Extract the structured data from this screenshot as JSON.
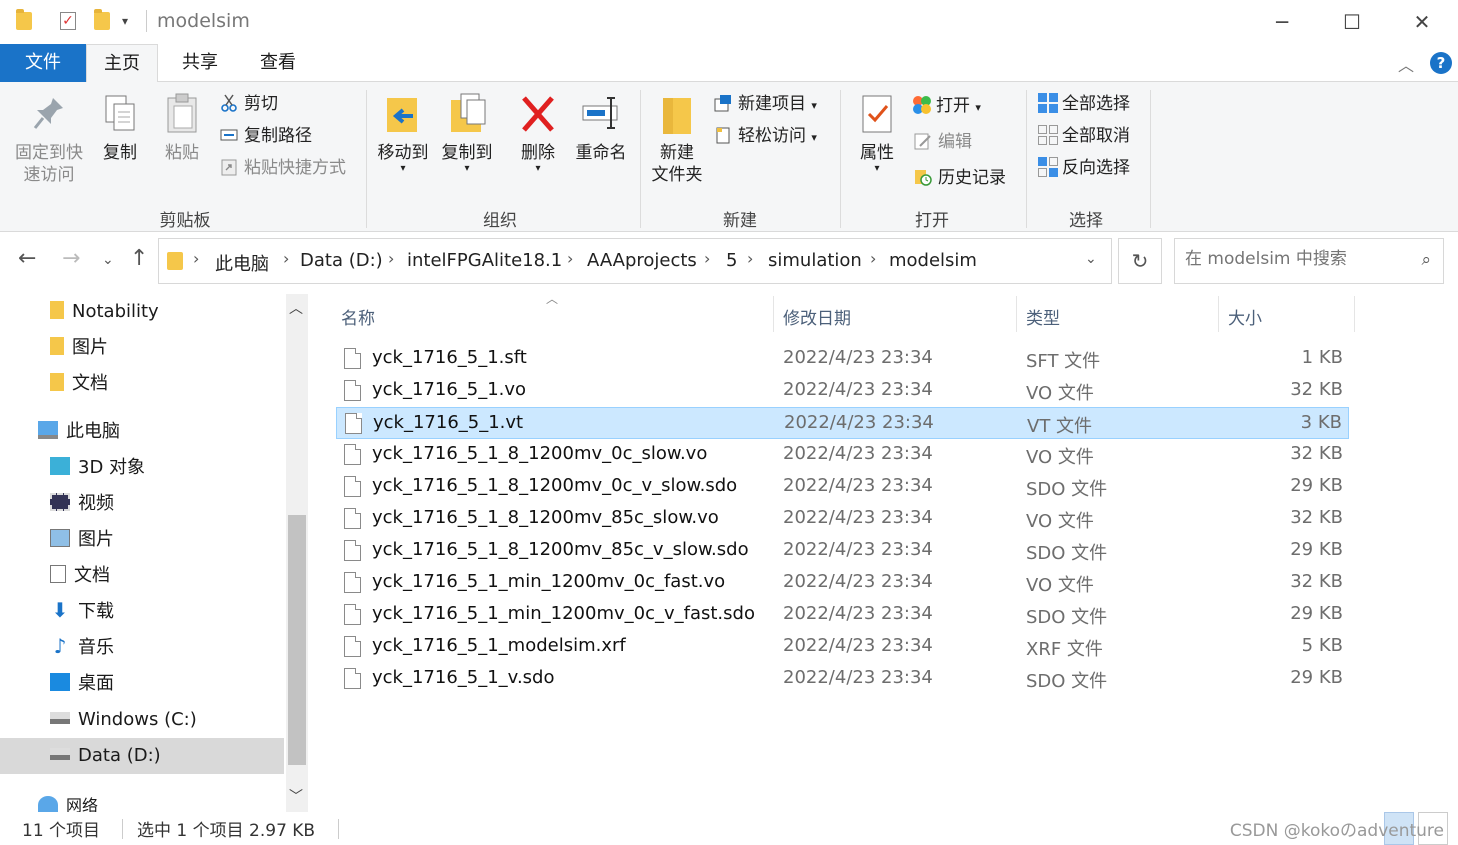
{
  "window": {
    "title": "modelsim",
    "min_glyph": "─",
    "max_glyph": "☐",
    "close_glyph": "✕"
  },
  "tabs": {
    "file": "文件",
    "home": "主页",
    "share": "共享",
    "view": "查看"
  },
  "ribbon": {
    "clipboard": {
      "label": "剪贴板",
      "pin_line1": "固定到快",
      "pin_line2": "速访问",
      "copy": "复制",
      "paste": "粘贴",
      "cut": "剪切",
      "copy_path": "复制路径",
      "paste_shortcut": "粘贴快捷方式"
    },
    "organize": {
      "label": "组织",
      "move_to": "移动到",
      "copy_to": "复制到",
      "delete": "删除",
      "rename": "重命名"
    },
    "new": {
      "label": "新建",
      "new_folder_line1": "新建",
      "new_folder_line2": "文件夹",
      "new_item": "新建项目",
      "easy_access": "轻松访问"
    },
    "open": {
      "label": "打开",
      "properties": "属性",
      "open": "打开",
      "edit": "编辑",
      "history": "历史记录"
    },
    "select": {
      "label": "选择",
      "select_all": "全部选择",
      "select_none": "全部取消",
      "invert": "反向选择"
    }
  },
  "breadcrumb": [
    "此电脑",
    "Data (D:)",
    "intelFPGAlite18.1",
    "AAAprojects",
    "5",
    "simulation",
    "modelsim"
  ],
  "search": {
    "placeholder": "在 modelsim 中搜索"
  },
  "sidebar": {
    "items": [
      {
        "label": "Notability",
        "icon": "folder-icon"
      },
      {
        "label": "图片",
        "icon": "folder-icon"
      },
      {
        "label": "文档",
        "icon": "folder-icon"
      },
      {
        "label": "此电脑",
        "icon": "computer-icon"
      },
      {
        "label": "3D 对象",
        "icon": "cube-icon"
      },
      {
        "label": "视频",
        "icon": "video-icon"
      },
      {
        "label": "图片",
        "icon": "pictures-icon"
      },
      {
        "label": "文档",
        "icon": "documents-icon"
      },
      {
        "label": "下载",
        "icon": "download-icon"
      },
      {
        "label": "音乐",
        "icon": "music-icon"
      },
      {
        "label": "桌面",
        "icon": "desktop-icon"
      },
      {
        "label": "Windows (C:)",
        "icon": "drive-icon"
      },
      {
        "label": "Data (D:)",
        "icon": "drive-icon"
      },
      {
        "label": "网络",
        "icon": "network-icon"
      }
    ],
    "selected": "Data (D:)"
  },
  "columns": {
    "name": "名称",
    "date": "修改日期",
    "type": "类型",
    "size": "大小"
  },
  "files": [
    {
      "name": "yck_1716_5_1.sft",
      "date": "2022/4/23 23:34",
      "type": "SFT 文件",
      "size": "1 KB"
    },
    {
      "name": "yck_1716_5_1.vo",
      "date": "2022/4/23 23:34",
      "type": "VO 文件",
      "size": "32 KB"
    },
    {
      "name": "yck_1716_5_1.vt",
      "date": "2022/4/23 23:34",
      "type": "VT 文件",
      "size": "3 KB"
    },
    {
      "name": "yck_1716_5_1_8_1200mv_0c_slow.vo",
      "date": "2022/4/23 23:34",
      "type": "VO 文件",
      "size": "32 KB"
    },
    {
      "name": "yck_1716_5_1_8_1200mv_0c_v_slow.sdo",
      "date": "2022/4/23 23:34",
      "type": "SDO 文件",
      "size": "29 KB"
    },
    {
      "name": "yck_1716_5_1_8_1200mv_85c_slow.vo",
      "date": "2022/4/23 23:34",
      "type": "VO 文件",
      "size": "32 KB"
    },
    {
      "name": "yck_1716_5_1_8_1200mv_85c_v_slow.sdo",
      "date": "2022/4/23 23:34",
      "type": "SDO 文件",
      "size": "29 KB"
    },
    {
      "name": "yck_1716_5_1_min_1200mv_0c_fast.vo",
      "date": "2022/4/23 23:34",
      "type": "VO 文件",
      "size": "32 KB"
    },
    {
      "name": "yck_1716_5_1_min_1200mv_0c_v_fast.sdo",
      "date": "2022/4/23 23:34",
      "type": "SDO 文件",
      "size": "29 KB"
    },
    {
      "name": "yck_1716_5_1_modelsim.xrf",
      "date": "2022/4/23 23:34",
      "type": "XRF 文件",
      "size": "5 KB"
    },
    {
      "name": "yck_1716_5_1_v.sdo",
      "date": "2022/4/23 23:34",
      "type": "SDO 文件",
      "size": "29 KB"
    }
  ],
  "selected_file": "yck_1716_5_1.vt",
  "status": {
    "count": "11 个项目",
    "selection": "选中 1 个项目  2.97 KB",
    "watermark": "CSDN @kokoのadventure"
  },
  "colors": {
    "accent": "#1a73c8",
    "selection_bg": "#cce8ff",
    "selection_border": "#99d1ff",
    "folder": "#f5c74a"
  }
}
